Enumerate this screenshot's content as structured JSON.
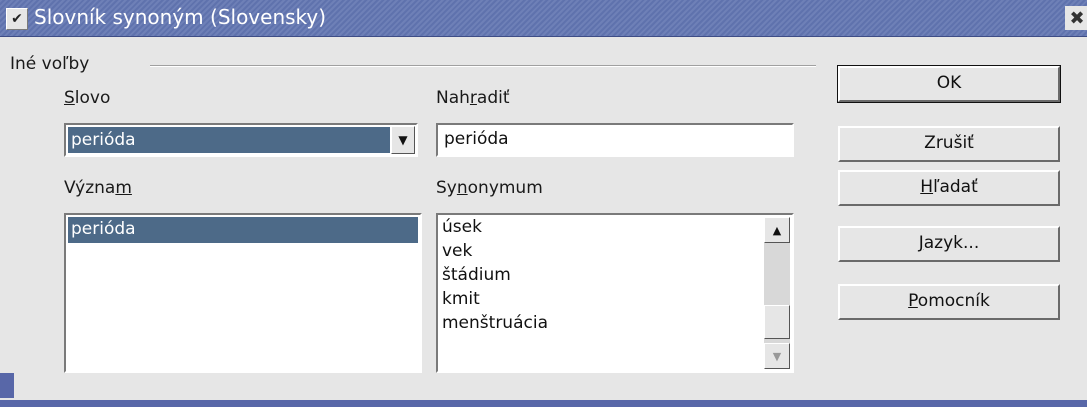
{
  "window": {
    "title": "Slovník synoným (Slovensky)",
    "menu_icon": "chevron-down-icon",
    "close_icon": "close-icon"
  },
  "group": {
    "label": "Iné voľby"
  },
  "word": {
    "label_pre": "",
    "label_key": "S",
    "label_post": "lovo",
    "value": "perióda"
  },
  "replace": {
    "label_pre": "Nah",
    "label_key": "r",
    "label_post": "adiť",
    "value": "perióda"
  },
  "meaning": {
    "label_pre": "Význa",
    "label_key": "m",
    "label_post": "",
    "items": [
      "perióda"
    ]
  },
  "synonym": {
    "label_pre": "Sy",
    "label_key": "n",
    "label_post": "onymum",
    "items": [
      "úsek",
      "vek",
      "štádium",
      "kmit",
      "menštruácia"
    ]
  },
  "buttons": {
    "ok": "OK",
    "cancel": "Zrušiť",
    "search_pre": "",
    "search_key": "H",
    "search_post": "ľadať",
    "language_pre": "",
    "language_key": "J",
    "language_post": "azyk...",
    "help_pre": "",
    "help_key": "P",
    "help_post": "omocník"
  },
  "colors": {
    "titlebar": "#6e80b7",
    "selection": "#4d6a88",
    "dialog_bg": "#e6e6e6"
  }
}
